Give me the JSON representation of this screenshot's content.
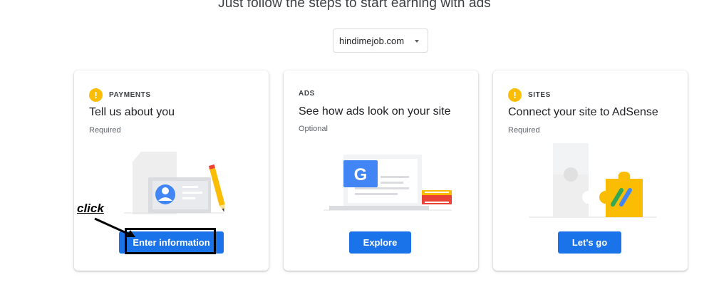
{
  "page": {
    "headline": "Just follow the steps to start earning with ads"
  },
  "site_selector": {
    "value": "hindimejob.com"
  },
  "cards": [
    {
      "category": "PAYMENTS",
      "title": "Tell us about you",
      "status": "Required",
      "button": "Enter information",
      "has_warning_icon": true
    },
    {
      "category": "ADS",
      "title": "See how ads look on your site",
      "status": "Optional",
      "button": "Explore",
      "has_warning_icon": false
    },
    {
      "category": "SITES",
      "title": "Connect your site to AdSense",
      "status": "Required",
      "button": "Let's go",
      "has_warning_icon": true
    }
  ],
  "annotation": {
    "label": "click"
  },
  "icons": {
    "warning": "!",
    "google_g": "G"
  },
  "colors": {
    "primary": "#1a73e8",
    "warning": "#fbbc04",
    "google_blue": "#4285f4",
    "google_red": "#ea4335",
    "google_green": "#34a853"
  }
}
